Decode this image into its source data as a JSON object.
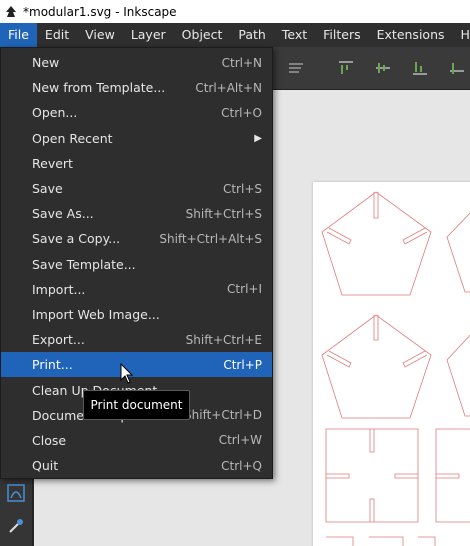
{
  "window": {
    "title": "*modular1.svg - Inkscape"
  },
  "menubar": {
    "items": [
      "File",
      "Edit",
      "View",
      "Layer",
      "Object",
      "Path",
      "Text",
      "Filters",
      "Extensions",
      "Help"
    ],
    "active": "File"
  },
  "file_menu": {
    "items": [
      {
        "label": "New",
        "shortcut": "Ctrl+N"
      },
      {
        "label": "New from Template...",
        "shortcut": "Ctrl+Alt+N"
      },
      {
        "label": "Open...",
        "shortcut": "Ctrl+O"
      },
      {
        "label": "Open Recent",
        "shortcut": ""
      },
      {
        "label": "Revert",
        "shortcut": ""
      },
      {
        "label": "Save",
        "shortcut": "Ctrl+S"
      },
      {
        "label": "Save As...",
        "shortcut": "Shift+Ctrl+S"
      },
      {
        "label": "Save a Copy...",
        "shortcut": "Shift+Ctrl+Alt+S"
      },
      {
        "label": "Save Template...",
        "shortcut": ""
      },
      {
        "label": "Import...",
        "shortcut": "Ctrl+I"
      },
      {
        "label": "Import Web Image...",
        "shortcut": ""
      },
      {
        "label": "Export...",
        "shortcut": "Shift+Ctrl+E"
      },
      {
        "label": "Print...",
        "shortcut": "Ctrl+P"
      },
      {
        "label": "Clean Up Document",
        "shortcut": ""
      },
      {
        "label": "Document Properties...",
        "shortcut": "Shift+Ctrl+D"
      },
      {
        "label": "Close",
        "shortcut": "Ctrl+W"
      },
      {
        "label": "Quit",
        "shortcut": "Ctrl+Q"
      }
    ],
    "highlighted": "Print..."
  },
  "tooltip": {
    "text": "Print document"
  },
  "colors": {
    "highlight": "#1f64b8",
    "menu_bg": "#2e2e2e",
    "shape_stroke": "#e07a7a"
  }
}
